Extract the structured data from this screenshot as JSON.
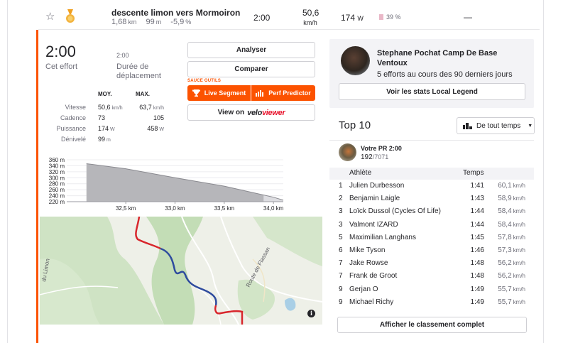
{
  "segment_row": {
    "name": "descente limon vers Mormoiron",
    "distance": "1,68",
    "distance_unit": "km",
    "elevation": "99",
    "elevation_unit": "m",
    "grade": "-5,9",
    "grade_unit": "%",
    "time": "2:00",
    "speed": "50,6",
    "speed_unit": "km/h",
    "power": "174",
    "power_unit": "W",
    "heart_rate": "39 %",
    "dash": "—"
  },
  "effort": {
    "elapsed_time": "2:00",
    "elapsed_label": "Cet effort",
    "moving_time": "2:00",
    "moving_label": "Durée de déplacement",
    "header_avg": "MOY.",
    "header_max": "MAX.",
    "rows": [
      {
        "label": "Vitesse",
        "avg": "50,6",
        "avg_unit": "km/h",
        "max": "63,7",
        "max_unit": "km/h"
      },
      {
        "label": "Cadence",
        "avg": "73",
        "avg_unit": "",
        "max": "105",
        "max_unit": ""
      },
      {
        "label": "Puissance",
        "avg": "174",
        "avg_unit": "W",
        "max": "458",
        "max_unit": "W"
      },
      {
        "label": "Dénivelé",
        "avg": "99",
        "avg_unit": "m",
        "max": "",
        "max_unit": ""
      }
    ]
  },
  "actions": {
    "analyze": "Analyser",
    "compare": "Comparer",
    "sauce_label": "SAUCE OUTILS",
    "live_segment": "Live Segment",
    "perf_predictor": "Perf Predictor",
    "view_on": "View on",
    "veloviewer_a": "velo",
    "veloviewer_b": "viewer"
  },
  "chart_data": {
    "type": "area",
    "x": [
      32.1,
      32.5,
      33.0,
      33.5,
      34.0,
      34.1
    ],
    "y": [
      347,
      330,
      300,
      272,
      235,
      225
    ],
    "x_ticks": [
      "32,5 km",
      "33,0 km",
      "33,5 km",
      "34,0 km"
    ],
    "x_tick_values": [
      32.5,
      33.0,
      33.5,
      34.0
    ],
    "y_ticks": [
      "360 m",
      "340 m",
      "320 m",
      "300 m",
      "280 m",
      "260 m",
      "240 m",
      "220 m"
    ],
    "y_tick_values": [
      360,
      340,
      320,
      300,
      280,
      260,
      240,
      220
    ],
    "xlim": [
      31.9,
      34.1
    ],
    "ylim": [
      220,
      360
    ],
    "segment_range": [
      32.1,
      33.9
    ],
    "colors": {
      "segment": "#b6b6ba",
      "outside": "#dcdce0",
      "line": "#8a8a90"
    }
  },
  "map": {
    "labels": [
      "du Limon",
      "Route de Flassan"
    ],
    "info": "i",
    "colors": {
      "route_in": "#2e4b9e",
      "route_out": "#d8262c"
    }
  },
  "local_legend": {
    "name": "Stephane Pochat Camp De Base Ventoux",
    "subtitle": "5 efforts au cours des 90 derniers jours",
    "button": "Voir les stats Local Legend"
  },
  "top10": {
    "title": "Top 10",
    "filter": "De tout temps",
    "pr_label": "Votre PR 2:00",
    "pr_rank": "192",
    "pr_total": "/7071",
    "col_athlete": "Athlète",
    "col_time": "Temps",
    "rows": [
      {
        "rank": "1",
        "name": "Julien Durbesson",
        "time": "1:41",
        "speed": "60,1",
        "unit": "km/h"
      },
      {
        "rank": "2",
        "name": "Benjamin Laigle",
        "time": "1:43",
        "speed": "58,9",
        "unit": "km/h"
      },
      {
        "rank": "3",
        "name": "Loïck Dussol (Cycles Of Life)",
        "time": "1:44",
        "speed": "58,4",
        "unit": "km/h"
      },
      {
        "rank": "3",
        "name": "Valmont IZARD",
        "time": "1:44",
        "speed": "58,4",
        "unit": "km/h"
      },
      {
        "rank": "5",
        "name": "Maximilian Langhans",
        "time": "1:45",
        "speed": "57,8",
        "unit": "km/h"
      },
      {
        "rank": "6",
        "name": "Mike Tyson",
        "time": "1:46",
        "speed": "57,3",
        "unit": "km/h"
      },
      {
        "rank": "7",
        "name": "Jake Rowse",
        "time": "1:48",
        "speed": "56,2",
        "unit": "km/h"
      },
      {
        "rank": "7",
        "name": "Frank de Groot",
        "time": "1:48",
        "speed": "56,2",
        "unit": "km/h"
      },
      {
        "rank": "9",
        "name": "Gerjan O",
        "time": "1:49",
        "speed": "55,7",
        "unit": "km/h"
      },
      {
        "rank": "9",
        "name": "Michael Richy",
        "time": "1:49",
        "speed": "55,7",
        "unit": "km/h"
      }
    ],
    "full_button": "Afficher le classement complet"
  },
  "colors": {
    "brand": "#fc5200",
    "text": "#242428",
    "muted": "#6d6d78"
  }
}
